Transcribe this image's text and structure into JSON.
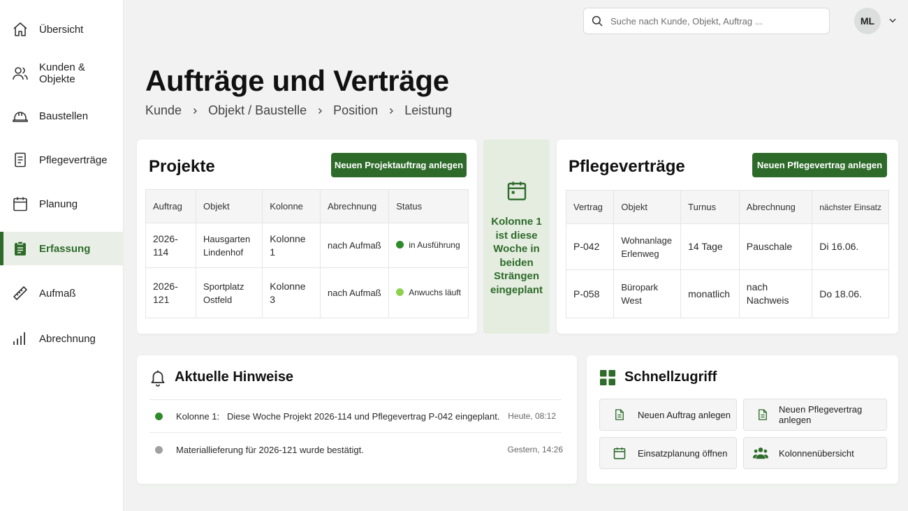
{
  "sidebar": {
    "items": [
      {
        "label": "Übersicht",
        "icon": "home-icon"
      },
      {
        "label": "Kunden & Objekte",
        "icon": "users-icon"
      },
      {
        "label": "Baustellen",
        "icon": "hardhat-icon"
      },
      {
        "label": "Pflegeverträge",
        "icon": "document-icon"
      },
      {
        "label": "Planung",
        "icon": "calendar-icon"
      },
      {
        "label": "Erfassung",
        "icon": "clipboard-icon"
      },
      {
        "label": "Aufmaß",
        "icon": "ruler-icon"
      },
      {
        "label": "Abrechnung",
        "icon": "bar-chart-icon"
      }
    ],
    "active_index": 5
  },
  "topbar": {
    "search_placeholder": "Suche nach Kunde, Objekt, Auftrag ...",
    "avatar_initials": "ML"
  },
  "header": {
    "title": "Aufträge und Verträge",
    "breadcrumb": [
      "Kunde",
      "Objekt / Baustelle",
      "Position",
      "Leistung"
    ]
  },
  "projekte": {
    "title": "Projekte",
    "button_label": "Neuen Projektauftrag anlegen",
    "columns": [
      "Auftrag",
      "Objekt",
      "Kolonne",
      "Abrechnung",
      "Status"
    ],
    "rows": [
      {
        "auftrag": "2026-114",
        "objekt": "Hausgarten Lindenhof",
        "kolonne": "Kolonne 1",
        "abrechnung": "nach Aufmaß",
        "status": "in Ausführung",
        "status_color": "#2e8b2a"
      },
      {
        "auftrag": "2026-121",
        "objekt": "Sportplatz Ostfeld",
        "kolonne": "Kolonne 3",
        "abrechnung": "nach Aufmaß",
        "status": "Anwuchs läuft",
        "status_color": "#8fd14f"
      }
    ]
  },
  "info_panel": {
    "icon": "calendar-icon",
    "text": "Kolonne 1 ist diese Woche in beiden Strängen eingeplant"
  },
  "pflegevertraege": {
    "title": "Pflegeverträge",
    "button_label": "Neuen Pflegevertrag anlegen",
    "columns": [
      "Vertrag",
      "Objekt",
      "Turnus",
      "Abrechnung",
      "nächster Einsatz"
    ],
    "rows": [
      {
        "vertrag": "P-042",
        "objekt": "Wohnanlage Erlenweg",
        "turnus": "14 Tage",
        "abrechnung": "Pauschale",
        "naechster": "Di 16.06."
      },
      {
        "vertrag": "P-058",
        "objekt": "Büropark West",
        "turnus": "monatlich",
        "abrechnung": "nach Nachweis",
        "naechster": "Do 18.06."
      }
    ]
  },
  "hinweise": {
    "title": "Aktuelle Hinweise",
    "items": [
      {
        "prefix": "Kolonne 1:",
        "text": "Diese Woche Projekt 2026-114 und Pflegevertrag P-042 eingeplant.",
        "time": "Heute, 08:12",
        "dot_color": "#2e8b2a"
      },
      {
        "prefix": "",
        "text": "Materiallieferung für 2026-121 wurde bestätigt.",
        "time": "Gestern, 14:26",
        "dot_color": "#a0a0a0"
      }
    ]
  },
  "schnellzugriff": {
    "title": "Schnellzugriff",
    "buttons": [
      {
        "label": "Neuen Auftrag anlegen",
        "icon": "document-icon"
      },
      {
        "label": "Neuen Pflegevertrag anlegen",
        "icon": "document-icon"
      },
      {
        "label": "Einsatzplanung öffnen",
        "icon": "calendar-icon"
      },
      {
        "label": "Kolonnenübersicht",
        "icon": "team-icon"
      }
    ]
  },
  "colors": {
    "brand_green": "#2e6b2a",
    "active_bg": "#e9efe7",
    "info_panel_bg": "#e5ede1"
  }
}
